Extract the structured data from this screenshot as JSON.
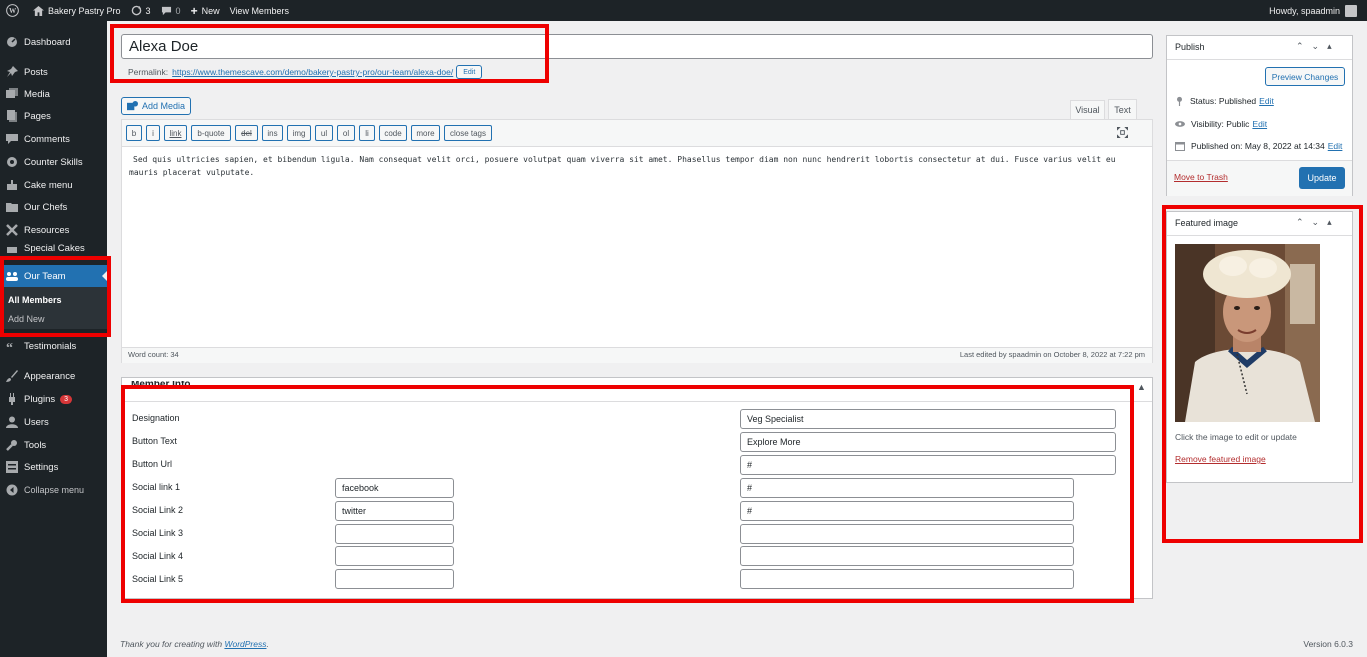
{
  "adminbar": {
    "site_name": "Bakery Pastry Pro",
    "updates_count": "3",
    "comments_count": "0",
    "new_label": "New",
    "view_label": "View Members",
    "howdy": "Howdy, spaadmin"
  },
  "sidebar": {
    "items": [
      {
        "label": "Dashboard",
        "icon": "dashboard-icon"
      },
      {
        "label": "Posts",
        "icon": "pin-icon"
      },
      {
        "label": "Media",
        "icon": "media-icon"
      },
      {
        "label": "Pages",
        "icon": "pages-icon"
      },
      {
        "label": "Comments",
        "icon": "comment-icon"
      },
      {
        "label": "Counter Skills",
        "icon": "gear-icon"
      },
      {
        "label": "Cake menu",
        "icon": "cake-icon"
      },
      {
        "label": "Our Chefs",
        "icon": "folder-icon"
      },
      {
        "label": "Resources",
        "icon": "resources-icon"
      },
      {
        "label": "Special Cakes",
        "icon": "cake-icon"
      },
      {
        "label": "Our Team",
        "icon": "team-icon"
      },
      {
        "label": "Testimonials",
        "icon": "quote-icon"
      },
      {
        "label": "Appearance",
        "icon": "brush-icon"
      },
      {
        "label": "Plugins",
        "icon": "plugin-icon",
        "badge": "3"
      },
      {
        "label": "Users",
        "icon": "users-icon"
      },
      {
        "label": "Tools",
        "icon": "wrench-icon"
      },
      {
        "label": "Settings",
        "icon": "settings-icon"
      },
      {
        "label": "Collapse menu",
        "icon": "collapse-icon"
      }
    ],
    "submenu": [
      "All Members",
      "Add New"
    ]
  },
  "editor": {
    "title": "Alexa Doe",
    "permalink_label": "Permalink:",
    "permalink_url": "https://www.themescave.com/demo/bakery-pastry-pro/our-team/alexa-doe/",
    "edit_label": "Edit",
    "add_media": "Add Media",
    "tab_visual": "Visual",
    "tab_text": "Text",
    "quicktags": [
      "b",
      "i",
      "link",
      "b-quote",
      "del",
      "ins",
      "img",
      "ul",
      "ol",
      "li",
      "code",
      "more",
      "close tags"
    ],
    "content": "Sed quis ultricies sapien, et bibendum ligula. Nam consequat velit orci, posuere volutpat quam viverra sit amet. Phasellus tempor diam non nunc hendrerit lobortis consectetur at dui. Fusce varius velit eu mauris placerat vulputate.",
    "word_count": "Word count: 34",
    "last_edited": "Last edited by spaadmin on October 8, 2022 at 7:22 pm"
  },
  "member_info": {
    "title": "Member Info",
    "designation_label": "Designation",
    "designation_value": "Veg Specialist",
    "button_text_label": "Button Text",
    "button_text_value": "Explore More",
    "button_url_label": "Button Url",
    "button_url_value": "#",
    "social": [
      {
        "label": "Social link 1",
        "name": "facebook",
        "url": "#"
      },
      {
        "label": "Social Link 2",
        "name": "twitter",
        "url": "#"
      },
      {
        "label": "Social Link 3",
        "name": "",
        "url": ""
      },
      {
        "label": "Social Link 4",
        "name": "",
        "url": ""
      },
      {
        "label": "Social Link 5",
        "name": "",
        "url": ""
      }
    ]
  },
  "publish": {
    "title": "Publish",
    "preview": "Preview Changes",
    "status": "Status: Published",
    "visibility": "Visibility: Public",
    "published_on": "Published on: May 8, 2022 at 14:34",
    "edit": "Edit",
    "trash": "Move to Trash",
    "update": "Update"
  },
  "featured": {
    "title": "Featured image",
    "hint": "Click the image to edit or update",
    "remove": "Remove featured image"
  },
  "footer": {
    "thanks": "Thank you for creating with",
    "wp_link": "WordPress",
    "version": "Version 6.0.3"
  },
  "colors": {
    "accent": "#2271b1",
    "sidebar": "#1d2327",
    "highlight": "#ee0000"
  }
}
